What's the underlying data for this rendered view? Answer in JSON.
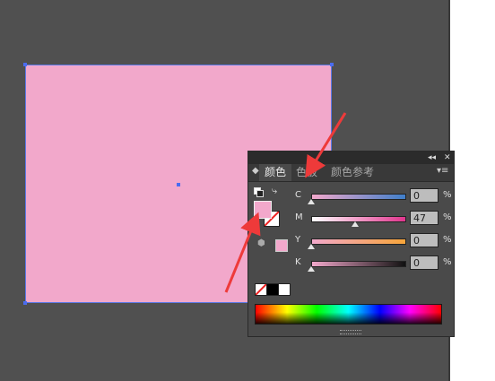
{
  "colors": {
    "fill": "#f2a8cb",
    "canvas": "#505050",
    "arrow": "#ee3a3a"
  },
  "panel": {
    "title_controls": {
      "collapse": "◂◂",
      "close": "✕"
    },
    "tabs": [
      {
        "label": "颜色",
        "active": true
      },
      {
        "label": "色板",
        "active": false
      },
      {
        "label": "颜色参考",
        "active": false
      }
    ],
    "menu_icon": "▾≡",
    "sliders": [
      {
        "label": "C",
        "value": "0",
        "unit": "%",
        "level": 0
      },
      {
        "label": "M",
        "value": "47",
        "unit": "%",
        "level": 47
      },
      {
        "label": "Y",
        "value": "0",
        "unit": "%",
        "level": 0
      },
      {
        "label": "K",
        "value": "0",
        "unit": "%",
        "level": 0
      }
    ]
  }
}
